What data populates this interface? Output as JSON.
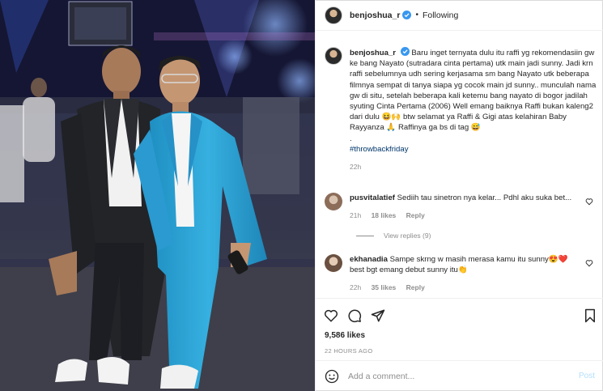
{
  "post": {
    "username": "benjoshua_r",
    "dot": "•",
    "follow_label": "Following"
  },
  "caption": {
    "username": "benjoshua_r",
    "text": "Baru inget ternyata dulu itu raffi yg rekomendasiin gw ke bang Nayato (sutradara cinta pertama) utk main jadi sunny. Jadi krn raffi sebelumnya udh sering kerjasama sm bang Nayato utk beberapa filmnya sempat di tanya siapa yg cocok main jd sunny.. munculah nama gw di situ, setelah beberapa kali ketemu bang nayato di bogor jadilah syuting Cinta Pertama (2006) Well emang baiknya Raffi bukan kaleng2 dari dulu 😆🙌 btw selamat ya Raffi & Gigi atas kelahiran Baby Rayyanza 🙏 Raffinya ga bs di tag 😅",
    "dot_line": ".",
    "hashtag": "#throwbackfriday",
    "time": "22h"
  },
  "comments": [
    {
      "username": "pusvitalatief",
      "text": "Sediih tau sinetron nya kelar... Pdhl aku suka bet...",
      "time": "21h",
      "likes": "18 likes",
      "reply": "Reply",
      "view_replies": "View replies (9)"
    },
    {
      "username": "ekhanadia",
      "text": "Sampe skrng w masih merasa kamu itu sunny😍❤️ best bgt emang debut sunny itu👏",
      "time": "22h",
      "likes": "35 likes",
      "reply": "Reply"
    }
  ],
  "stats": {
    "likes": "9,586 likes",
    "ago": "22 HOURS AGO"
  },
  "add_comment": {
    "placeholder": "Add a comment...",
    "post_label": "Post"
  },
  "colors": {
    "verified": "#3897f0",
    "link": "#00376b",
    "muted": "#8e8e8e",
    "post_disabled": "#b2dffc",
    "suit_blue": "#2fa4d6"
  },
  "icons": [
    "verified-badge-icon",
    "heart-icon",
    "comment-icon",
    "share-icon",
    "bookmark-icon",
    "emoji-icon"
  ]
}
